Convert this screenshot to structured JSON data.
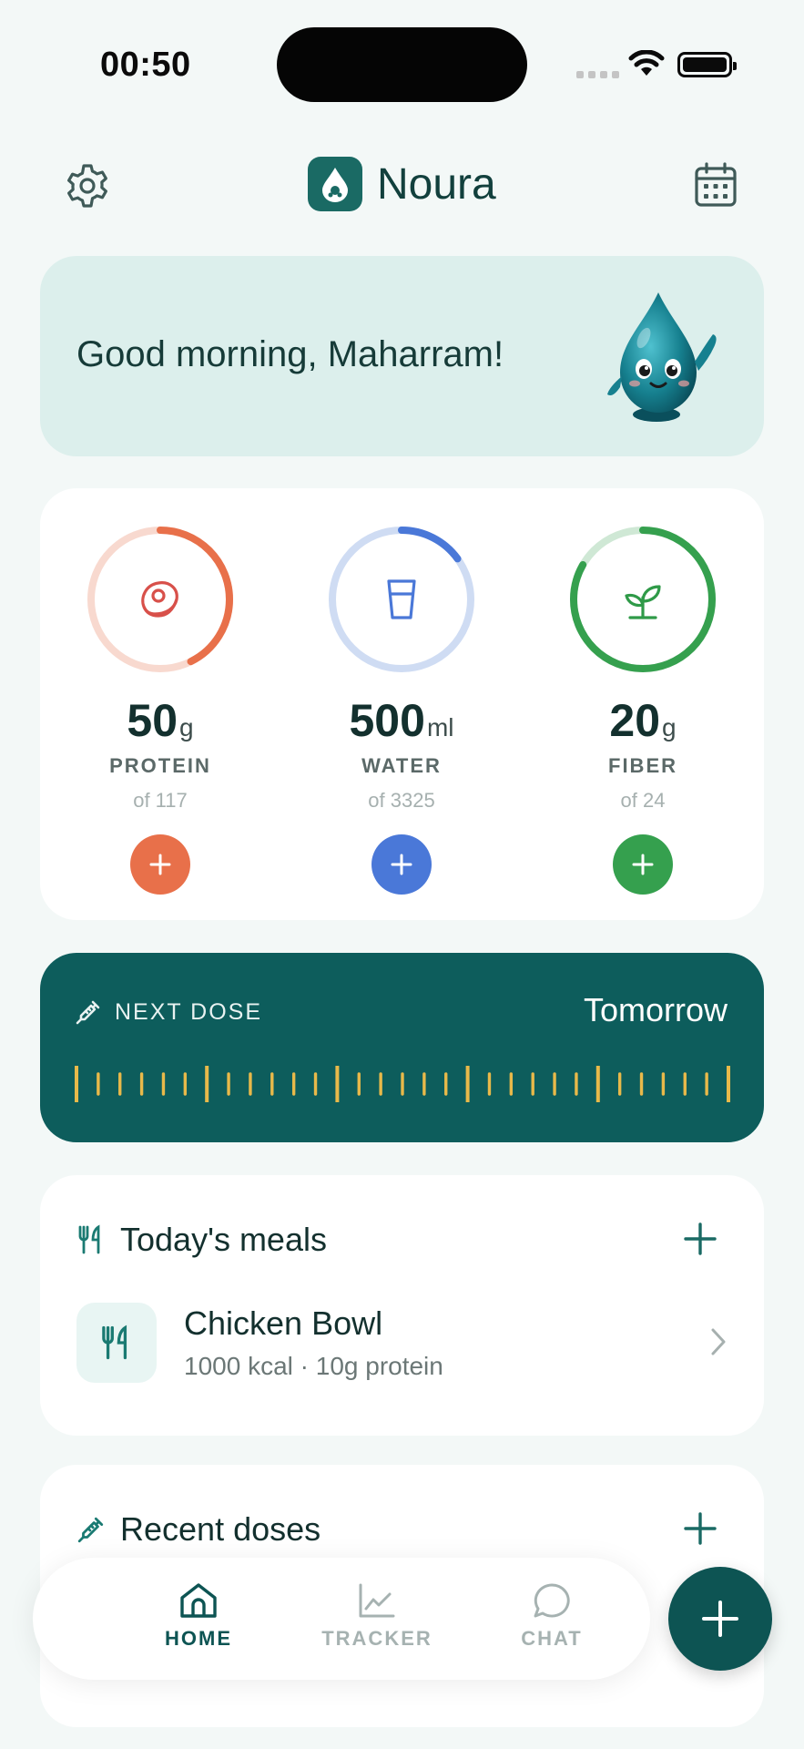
{
  "status_bar": {
    "time": "00:50"
  },
  "header": {
    "app_name": "Noura"
  },
  "greeting": {
    "text": "Good morning, Maharram!"
  },
  "macros": [
    {
      "value": "50",
      "unit": "g",
      "label": "PROTEIN",
      "target": "of 117",
      "progress": 0.427,
      "color": "#e8704a",
      "track_color": "#f8d9cf"
    },
    {
      "value": "500",
      "unit": "ml",
      "label": "WATER",
      "target": "of 3325",
      "progress": 0.15,
      "color": "#4a78d8",
      "track_color": "#cfdcf3"
    },
    {
      "value": "20",
      "unit": "g",
      "label": "FIBER",
      "target": "of 24",
      "progress": 0.833,
      "color": "#35a04e",
      "track_color": "#cfe8d5"
    }
  ],
  "next_dose": {
    "label": "NEXT DOSE",
    "when": "Tomorrow",
    "tick_color": "#e8b94a"
  },
  "meals": {
    "title": "Today's meals",
    "items": [
      {
        "name": "Chicken Bowl",
        "meta": "1000 kcal · 10g protein"
      }
    ]
  },
  "recent_doses": {
    "title": "Recent doses"
  },
  "nav": {
    "items": [
      {
        "label": "HOME",
        "active": true
      },
      {
        "label": "TRACKER",
        "active": false
      },
      {
        "label": "CHAT",
        "active": false
      }
    ],
    "active_color": "#0d5453",
    "inactive_color": "#a6b2b1"
  },
  "colors": {
    "primary": "#0d5d5c",
    "background": "#f3f8f7",
    "greeting_bg": "#dcefec"
  }
}
